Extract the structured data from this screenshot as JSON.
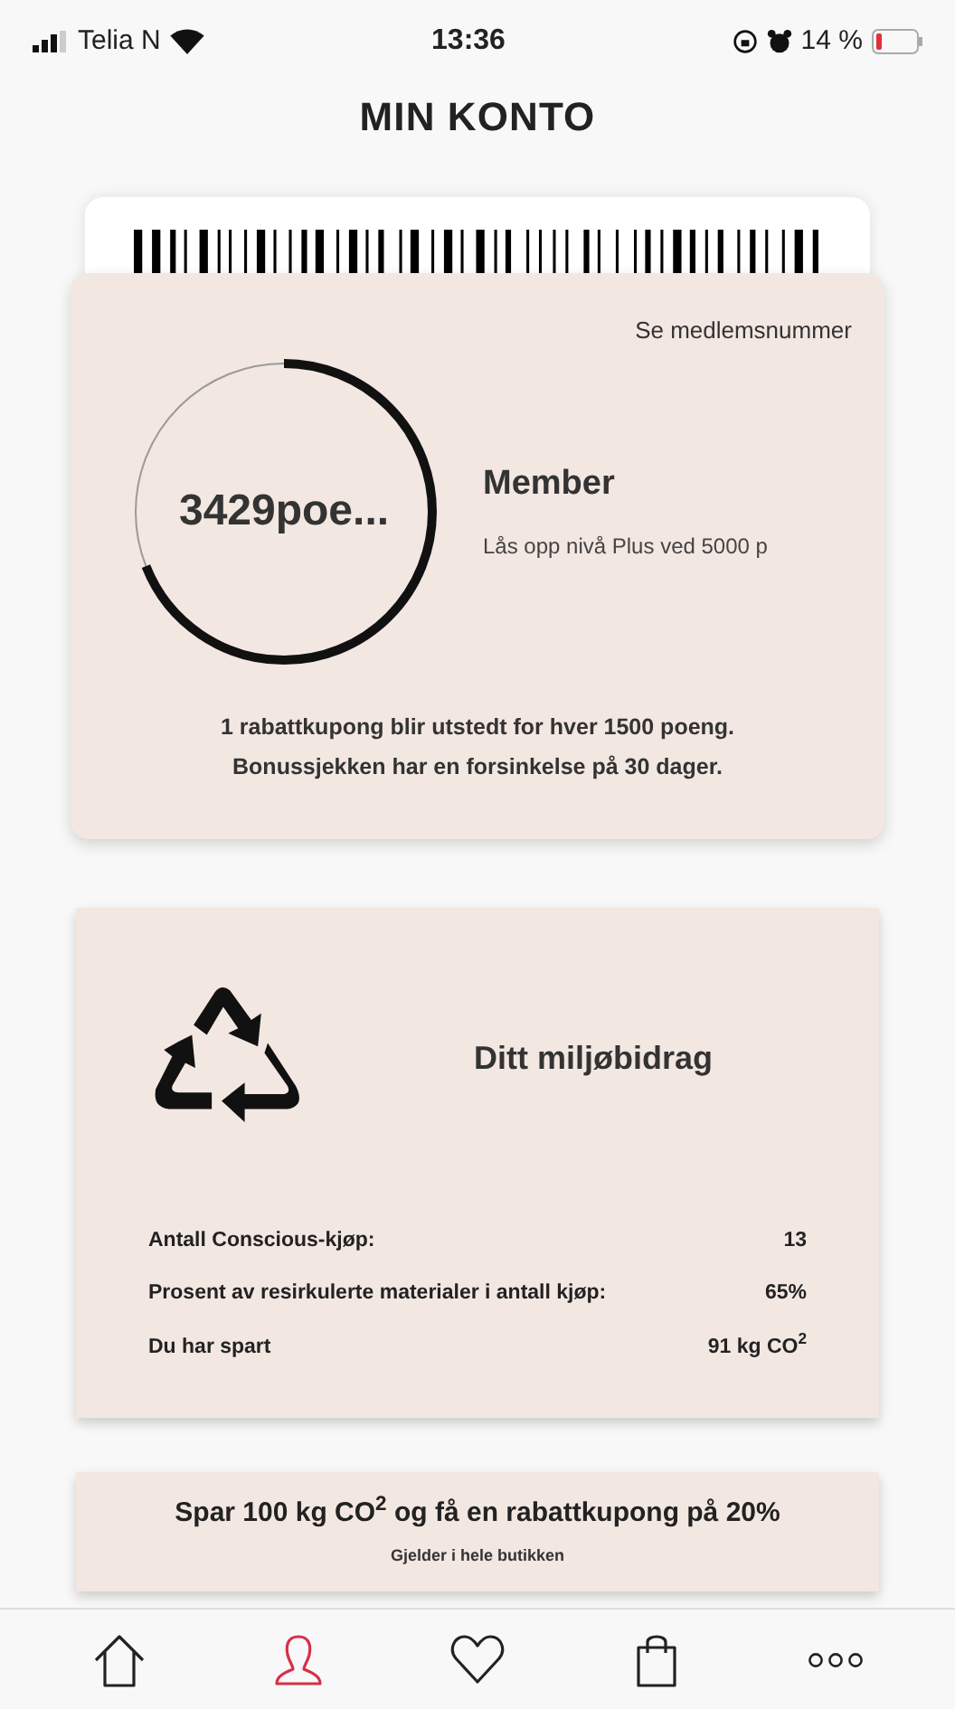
{
  "status_bar": {
    "carrier": "Telia N",
    "time": "13:36",
    "battery": "14 %"
  },
  "header": {
    "title": "MIN KONTO"
  },
  "member_card": {
    "link": "Se medlemsnummer",
    "points": "3429poe...",
    "tier": "Member",
    "unlock": "Lås opp nivå Plus ved 5000 p",
    "info": [
      "1 rabattkupong blir utstedt for hver 1500 poeng.",
      "Bonussjekken har en forsinkelse på 30 dager."
    ]
  },
  "eco_card": {
    "title": "Ditt miljøbidrag",
    "stats": [
      {
        "label": "Antall Conscious-kjøp:",
        "value": "13"
      },
      {
        "label": "Prosent av resirkulerte materialer i antall kjøp:",
        "value": "65%"
      },
      {
        "label": "Du har spart",
        "value": "91 kg CO$^{2}$"
      }
    ]
  },
  "promo": {
    "title": "Spar 100 kg CO$^{2}$ og få en rabattkupong på 20%",
    "subtitle": "Gjelder i hele butikken"
  },
  "tab_bar": [
    {
      "kind": "home",
      "selected": false
    },
    {
      "kind": "profile",
      "selected": true
    },
    {
      "kind": "heart",
      "selected": false
    },
    {
      "kind": "bag",
      "selected": false
    },
    {
      "kind": "more",
      "selected": false
    }
  ]
}
